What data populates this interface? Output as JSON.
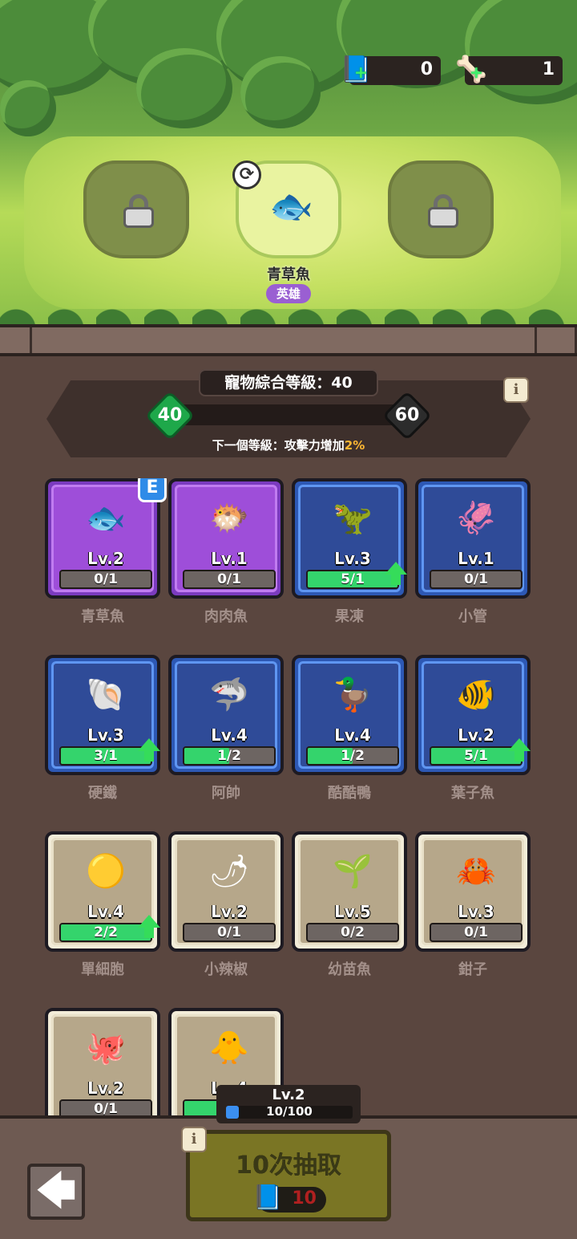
{
  "resources": {
    "tickets": {
      "icon": "ticket-book-icon",
      "value": "0"
    },
    "bones": {
      "icon": "bone-icon",
      "value": "1"
    }
  },
  "slots": [
    {
      "state": "locked",
      "icon": "lock-icon"
    },
    {
      "state": "active",
      "pet_icon": "green-fish-icon",
      "name": "青草魚",
      "rarity": "英雄"
    },
    {
      "state": "locked",
      "icon": "lock-icon"
    }
  ],
  "pet_level": {
    "title": "寵物綜合等級：40",
    "current": "40",
    "next": "60",
    "progress": 0.0,
    "next_prefix": "下一個等級：攻擊力增加",
    "next_pct": "2%"
  },
  "pets": [
    {
      "name": "青草魚",
      "level": "Lv.2",
      "progress": "0/1",
      "fill": 0.0,
      "rarity": "purple",
      "icon": "🐟",
      "equipped": true,
      "upgrade": false
    },
    {
      "name": "肉肉魚",
      "level": "Lv.1",
      "progress": "0/1",
      "fill": 0.0,
      "rarity": "purple",
      "icon": "🐡",
      "equipped": false,
      "upgrade": false
    },
    {
      "name": "果凍",
      "level": "Lv.3",
      "progress": "5/1",
      "fill": 1.0,
      "rarity": "blue",
      "icon": "🦖",
      "equipped": false,
      "upgrade": true
    },
    {
      "name": "小管",
      "level": "Lv.1",
      "progress": "0/1",
      "fill": 0.0,
      "rarity": "blue",
      "icon": "🦑",
      "equipped": false,
      "upgrade": false
    },
    {
      "name": "硬鐵",
      "level": "Lv.3",
      "progress": "3/1",
      "fill": 1.0,
      "rarity": "blue",
      "icon": "🐚",
      "equipped": false,
      "upgrade": true
    },
    {
      "name": "阿帥",
      "level": "Lv.4",
      "progress": "1/2",
      "fill": 0.5,
      "rarity": "blue",
      "icon": "🦈",
      "equipped": false,
      "upgrade": false
    },
    {
      "name": "酷酷鴨",
      "level": "Lv.4",
      "progress": "1/2",
      "fill": 0.5,
      "rarity": "blue",
      "icon": "🦆",
      "equipped": false,
      "upgrade": false
    },
    {
      "name": "葉子魚",
      "level": "Lv.2",
      "progress": "5/1",
      "fill": 1.0,
      "rarity": "blue",
      "icon": "🐠",
      "equipped": false,
      "upgrade": true
    },
    {
      "name": "單細胞",
      "level": "Lv.4",
      "progress": "2/2",
      "fill": 1.0,
      "rarity": "tan",
      "icon": "🟡",
      "equipped": false,
      "upgrade": true
    },
    {
      "name": "小辣椒",
      "level": "Lv.2",
      "progress": "0/1",
      "fill": 0.0,
      "rarity": "tan",
      "icon": "🌶",
      "equipped": false,
      "upgrade": false
    },
    {
      "name": "幼苗魚",
      "level": "Lv.5",
      "progress": "0/2",
      "fill": 0.0,
      "rarity": "tan",
      "icon": "🌱",
      "equipped": false,
      "upgrade": false
    },
    {
      "name": "鉗子",
      "level": "Lv.3",
      "progress": "0/1",
      "fill": 0.0,
      "rarity": "tan",
      "icon": "🦀",
      "equipped": false,
      "upgrade": false
    },
    {
      "name": "",
      "level": "Lv.2",
      "progress": "0/1",
      "fill": 0.0,
      "rarity": "tan",
      "icon": "🐙",
      "equipped": false,
      "upgrade": false
    },
    {
      "name": "",
      "level": "Lv.4",
      "progress": "2/2",
      "fill": 1.0,
      "rarity": "tan",
      "icon": "🐥",
      "equipped": false,
      "upgrade": false
    }
  ],
  "equipped_badge": "E",
  "info_label": "i",
  "summon": {
    "level": "Lv.2",
    "progress_text": "10/100",
    "progress": 0.1,
    "button_label": "10次抽取",
    "cost": "10",
    "cost_icon": "ticket-book-icon"
  },
  "back": {
    "icon": "back-arrow-icon",
    "glyph": "🡄"
  },
  "colors": {
    "purple_card": "#9e4ed9",
    "blue_card": "#2f4b98",
    "tan_card": "#b6a78a",
    "progress_green": "#34d46c",
    "accent_orange": "#ffb733",
    "level_diamond_green": "#1ea84a",
    "level_diamond_dark": "#2c2c2c"
  }
}
